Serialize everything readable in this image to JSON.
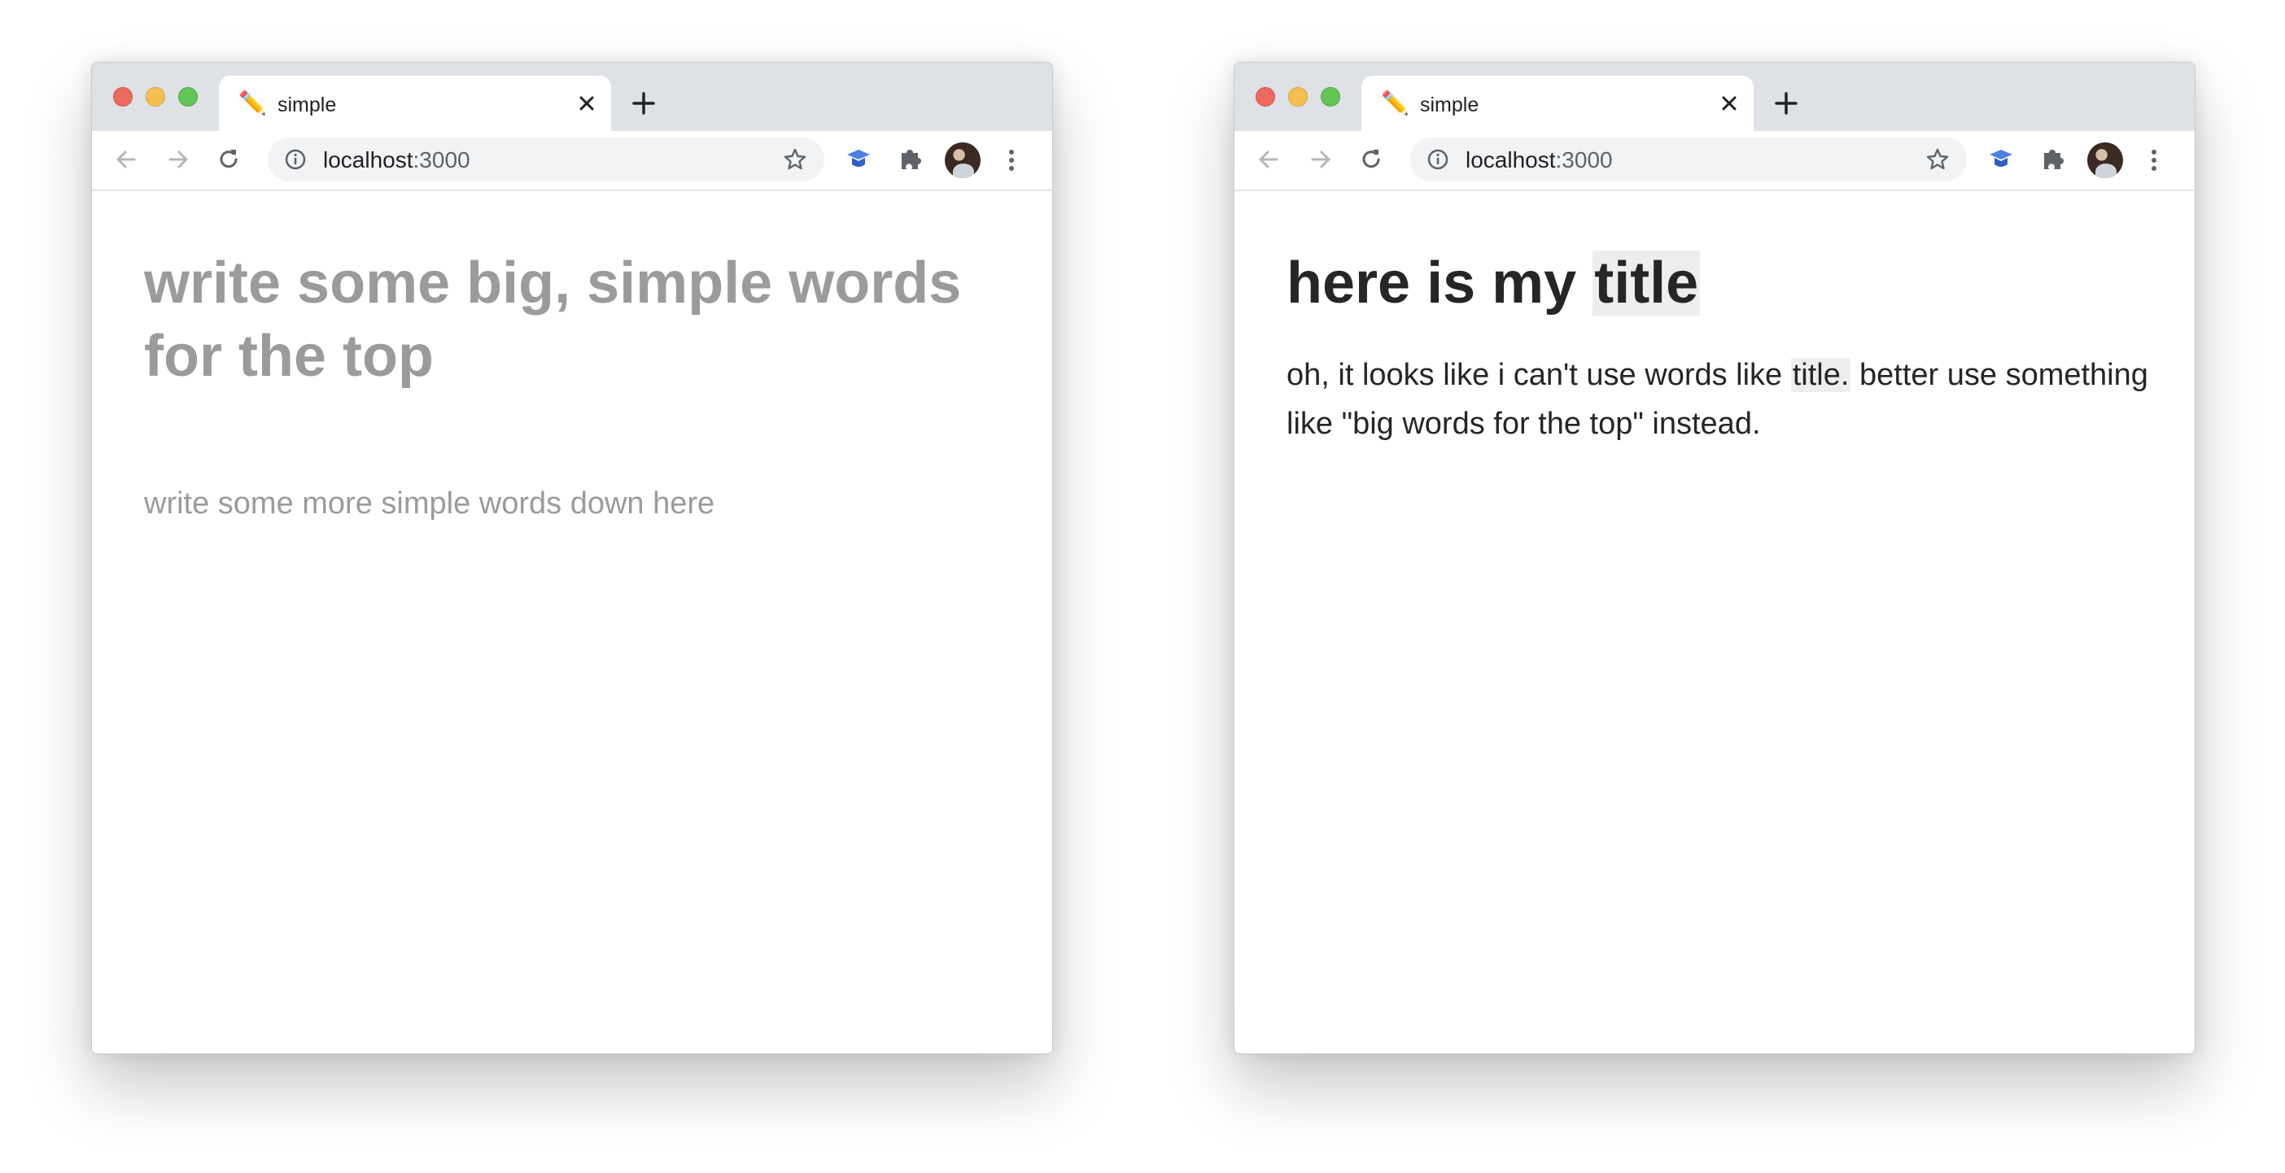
{
  "colors": {
    "titlebar": "#dee1e6",
    "close_light": "#ed6a5e",
    "minimize_light": "#f5bf4f",
    "maximize_light": "#62c554",
    "placeholder_text": "#9b9b9b",
    "body_text": "#262626",
    "highlight": "#eeeeee"
  },
  "browser": {
    "tab_title": "simple",
    "tab_favicon": "✏️",
    "url_host": "localhost",
    "url_port": ":3000",
    "icons": [
      "back-arrow-icon",
      "forward-arrow-icon",
      "reload-icon",
      "info-icon",
      "star-icon",
      "graduation-cap-extension-icon",
      "puzzle-extension-icon",
      "avatar",
      "kebab-menu-icon",
      "close-icon",
      "plus-icon"
    ]
  },
  "left_page": {
    "title_placeholder": "write some big, simple words for the top",
    "body_placeholder": "write some more simple words down here"
  },
  "right_page": {
    "heading_prefix": "here is my ",
    "heading_highlight": "title",
    "message_part1": "oh, it looks like i can't use words like ",
    "message_highlight": "title.",
    "message_part2": " better use something like \"big words for the top\" instead."
  }
}
